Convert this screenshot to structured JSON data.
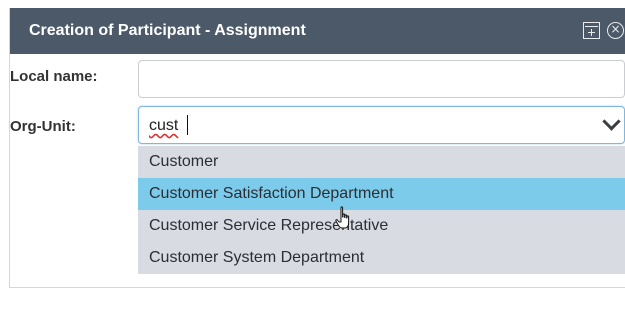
{
  "dialog": {
    "title": "Creation of Participant - Assignment",
    "expand_icon": "expand-icon",
    "close_icon": "close-icon",
    "close_glyph": "×"
  },
  "form": {
    "local_name_label": "Local name:",
    "local_name_value": "",
    "org_unit_label": "Org-Unit:",
    "org_unit_value": "cust"
  },
  "dropdown": {
    "options": [
      "Customer",
      "Customer Satisfaction Department",
      "Customer Service Representative",
      "Customer System Department"
    ],
    "hovered_index": 1
  },
  "colors": {
    "titlebar": "#4b5968",
    "dropdown_bg": "#d8dbe2",
    "hover_bg": "#7ccbea"
  }
}
